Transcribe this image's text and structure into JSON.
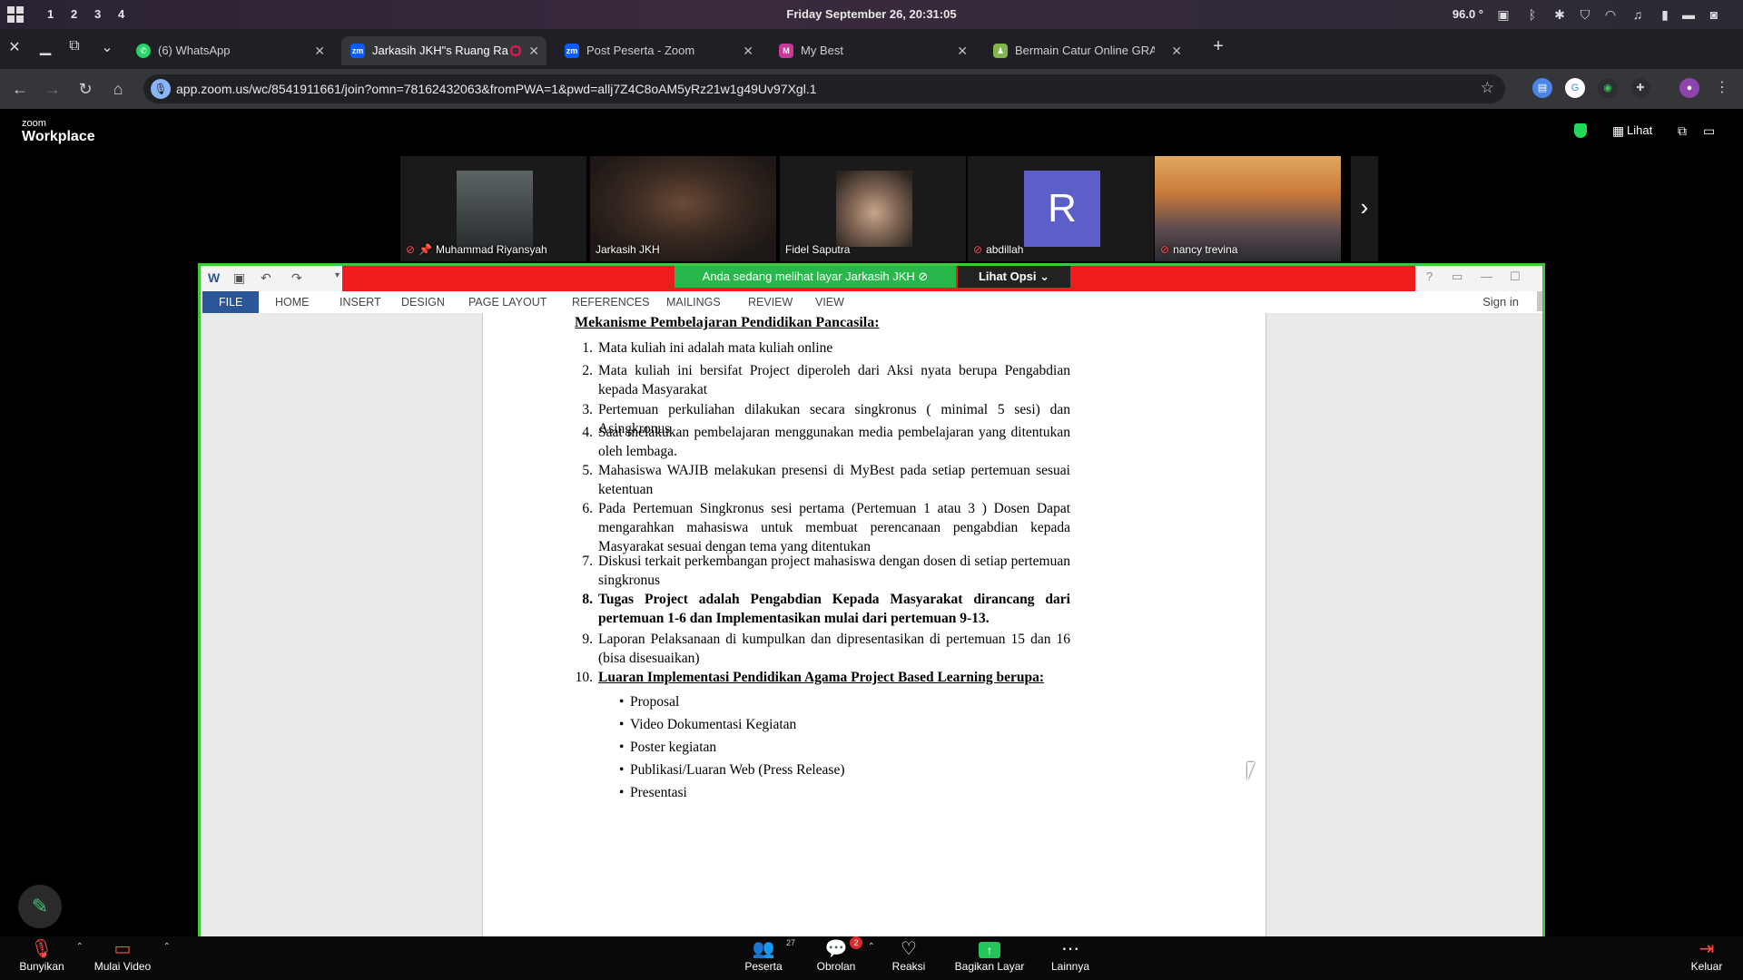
{
  "os": {
    "workspaces": [
      "1",
      "2",
      "3",
      "4"
    ],
    "clock": "Friday September 26, 20:31:05",
    "battery": "96.0 °"
  },
  "tabs": [
    {
      "title": "(6) WhatsApp",
      "icon": "whatsapp-icon",
      "color": "#25d366"
    },
    {
      "title": "Jarkasih JKH\"s Ruang Ra",
      "icon": "zoom-icon",
      "color": "#0b5cff",
      "active": true
    },
    {
      "title": "Post Peserta - Zoom",
      "icon": "zoom-icon",
      "color": "#0b5cff"
    },
    {
      "title": "My Best",
      "icon": "mybest-icon",
      "color": "#c8389a"
    },
    {
      "title": "Bermain Catur Online GRATIS",
      "icon": "chess-pawn-icon",
      "color": "#81b64c"
    }
  ],
  "address": {
    "url": "app.zoom.us/wc/8541911661/join?omn=78162432063&fromPWA=1&pwd=allj7Z4C8oAM5yRz21w1g49Uv97Xgl.1"
  },
  "zoom": {
    "brand_small": "zoom",
    "brand_large": "Workplace",
    "view_label": "Lihat",
    "participants": [
      {
        "name": "Muhammad Riyansyah",
        "muted": true,
        "pinned": true,
        "bg": "#3b3f3f"
      },
      {
        "name": "Jarkasih JKH",
        "muted": false,
        "speaking": true,
        "bg": "#4a3a30"
      },
      {
        "name": "Fidel Saputra",
        "muted": false,
        "bg": "#6a5a50"
      },
      {
        "name": "abdillah",
        "muted": true,
        "initial": "R",
        "bg": "#5b5fc7"
      },
      {
        "name": "nancy trevina",
        "muted": true,
        "bg": "#c98a4a"
      }
    ],
    "share_notice": "Anda sedang melihat layar  Jarkasih JKH",
    "view_options": "Lihat Opsi"
  },
  "word": {
    "ribbon_tabs": [
      "FILE",
      "HOME",
      "INSERT",
      "DESIGN",
      "PAGE LAYOUT",
      "REFERENCES",
      "MAILINGS",
      "REVIEW",
      "VIEW"
    ],
    "sign_in": "Sign in",
    "heading": "Mekanisme Pembelajaran Pendidikan Pancasila:",
    "items": [
      {
        "num": "1.",
        "text": "Mata kuliah ini adalah mata kuliah online"
      },
      {
        "num": "2.",
        "text": "Mata kuliah ini bersifat Project diperoleh dari Aksi nyata berupa Pengabdian kepada Masyarakat"
      },
      {
        "num": "3.",
        "text": "Pertemuan perkuliahan dilakukan secara singkronus ( minimal 5 sesi) dan Asingkronus"
      },
      {
        "num": "4.",
        "text": "Saat melakukan pembelajaran menggunakan media pembelajaran yang ditentukan oleh lembaga."
      },
      {
        "num": "5.",
        "text": "Mahasiswa WAJIB melakukan presensi di MyBest pada setiap pertemuan sesuai ketentuan"
      },
      {
        "num": "6.",
        "text": "Pada Pertemuan Singkronus sesi pertama (Pertemuan 1 atau 3 ) Dosen Dapat mengarahkan mahasiswa untuk membuat perencanaan pengabdian kepada Masyarakat sesuai dengan tema yang ditentukan"
      },
      {
        "num": "7.",
        "text": "Diskusi terkait perkembangan project mahasiswa dengan dosen di setiap pertemuan singkronus"
      },
      {
        "num": "8.",
        "text": "Tugas Project adalah Pengabdian Kepada Masyarakat dirancang dari pertemuan 1-6 dan Implementasikan mulai dari pertemuan 9-13."
      },
      {
        "num": "9.",
        "text": "Laporan Pelaksanaan di kumpulkan dan dipresentasikan di pertemuan 15 dan 16 (bisa disesuaikan)"
      },
      {
        "num": "10.",
        "text": "Luaran Implementasi Pendidikan Agama Project Based Learning berupa:"
      }
    ],
    "bullets": [
      "Proposal",
      "Video Dokumentasi Kegiatan",
      "Poster kegiatan",
      "Publikasi/Luaran Web (Press Release)",
      "Presentasi"
    ]
  },
  "toolbar": {
    "unmute": "Bunyikan",
    "start_video": "Mulai Video",
    "participants": "Peserta",
    "participants_count": "27",
    "chat": "Obrolan",
    "chat_badge": "2",
    "reactions": "Reaksi",
    "share": "Bagikan Layar",
    "more": "Lainnya",
    "leave": "Keluar"
  }
}
